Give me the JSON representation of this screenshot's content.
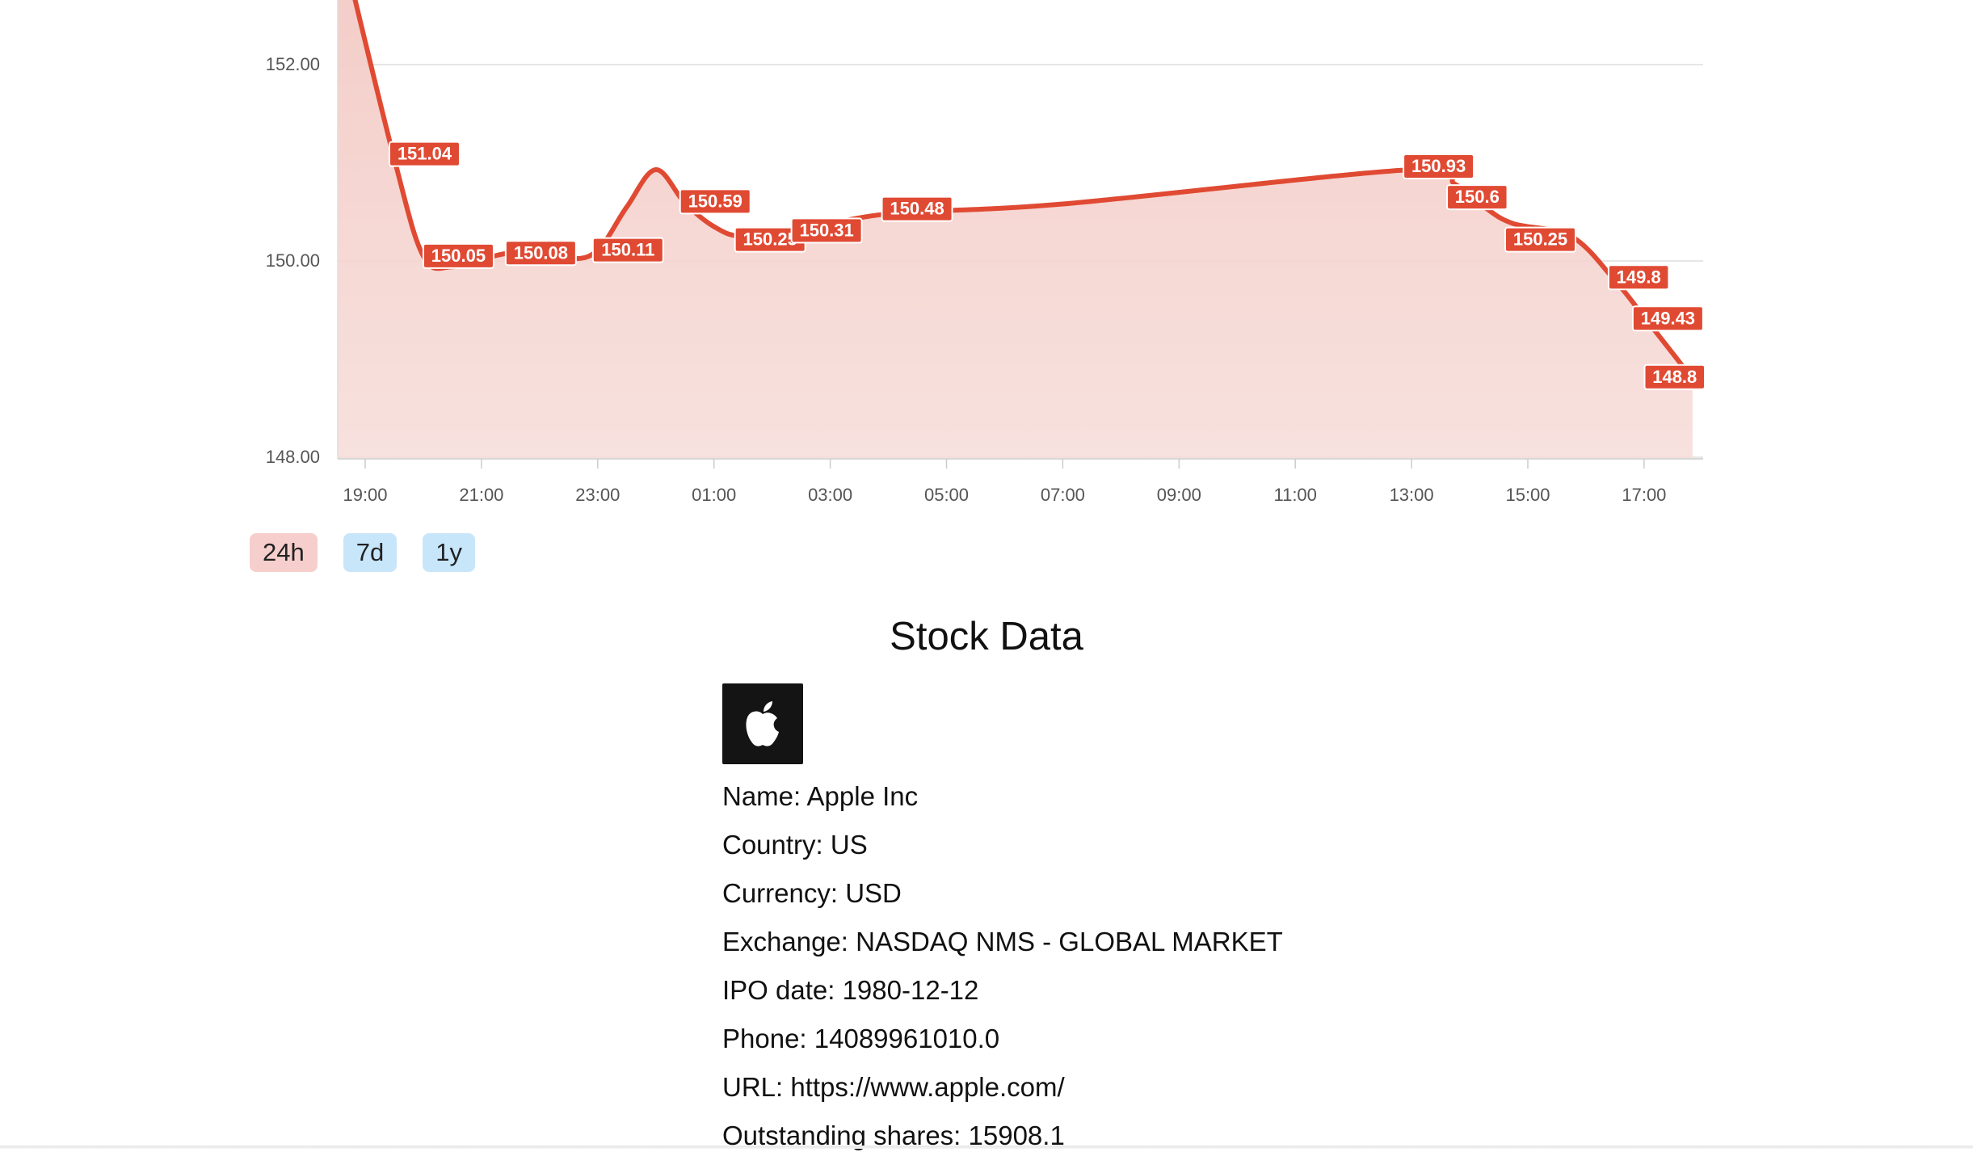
{
  "chart_data": {
    "type": "area",
    "x_ticks": [
      "19:00",
      "21:00",
      "23:00",
      "01:00",
      "03:00",
      "05:00",
      "07:00",
      "09:00",
      "11:00",
      "13:00",
      "15:00",
      "17:00"
    ],
    "y_ticks": [
      "148.00",
      "150.00",
      "152.00"
    ],
    "ylim": [
      148.0,
      152.75
    ],
    "grid": true,
    "line_color": "#e04a33",
    "fill_color": "#f3c9c4",
    "points": [
      {
        "x": "18:40",
        "y": 153.05
      },
      {
        "x": "19:30",
        "y": 151.04
      },
      {
        "x": "20:00",
        "y": 150.05
      },
      {
        "x": "20:30",
        "y": 149.94
      },
      {
        "x": "21:30",
        "y": 150.08
      },
      {
        "x": "22:30",
        "y": 150.02
      },
      {
        "x": "23:00",
        "y": 150.11
      },
      {
        "x": "23:30",
        "y": 150.55
      },
      {
        "x": "24:00",
        "y": 150.93
      },
      {
        "x": "24:30",
        "y": 150.59
      },
      {
        "x": "25:00",
        "y": 150.35
      },
      {
        "x": "25:30",
        "y": 150.25
      },
      {
        "x": "26:30",
        "y": 150.31
      },
      {
        "x": "28:00",
        "y": 150.48
      },
      {
        "x": "31:00",
        "y": 150.58
      },
      {
        "x": "37:00",
        "y": 150.93
      },
      {
        "x": "37:45",
        "y": 150.78
      },
      {
        "x": "38:15",
        "y": 150.55
      },
      {
        "x": "38:45",
        "y": 150.38
      },
      {
        "x": "39:45",
        "y": 150.25
      },
      {
        "x": "40:30",
        "y": 149.8
      },
      {
        "x": "41:00",
        "y": 149.43
      },
      {
        "x": "41:50",
        "y": 148.8
      }
    ],
    "data_labels": [
      {
        "x": "19:30",
        "y": 151.04,
        "text": "151.04"
      },
      {
        "x": "20:00",
        "y": 150.05,
        "text": "150.05"
      },
      {
        "x": "21:30",
        "y": 150.08,
        "text": "150.08"
      },
      {
        "x": "23:00",
        "y": 150.11,
        "text": "150.11"
      },
      {
        "x": "24:30",
        "y": 150.59,
        "text": "150.59"
      },
      {
        "x": "25:30",
        "y": 150.25,
        "text": "150.25"
      },
      {
        "x": "26:30",
        "y": 150.31,
        "text": "150.31"
      },
      {
        "x": "28:00",
        "y": 150.48,
        "text": "150.48"
      },
      {
        "x": "37:00",
        "y": 150.93,
        "text": "150.93"
      },
      {
        "x": "37:45",
        "y": 150.6,
        "text": "150.6"
      },
      {
        "x": "38:45",
        "y": 150.25,
        "text": "150.25"
      },
      {
        "x": "40:30",
        "y": 149.8,
        "text": "149.8"
      },
      {
        "x": "41:00",
        "y": 149.43,
        "text": "149.43"
      },
      {
        "x": "41:50",
        "y": 148.8,
        "text": "148.8"
      }
    ]
  },
  "range_buttons": [
    {
      "label": "24h",
      "active": true
    },
    {
      "label": "7d",
      "active": false
    },
    {
      "label": "1y",
      "active": false
    }
  ],
  "stock": {
    "title": "Stock Data",
    "logo_icon": "apple-logo-icon",
    "name": "Name: Apple Inc",
    "country": "Country: US",
    "currency": "Currency: USD",
    "exchange": "Exchange: NASDAQ NMS - GLOBAL MARKET",
    "ipo": "IPO date: 1980-12-12",
    "phone": "Phone: 14089961010.0",
    "url": "URL: https://www.apple.com/",
    "shares": "Outstanding shares: 15908.1"
  }
}
